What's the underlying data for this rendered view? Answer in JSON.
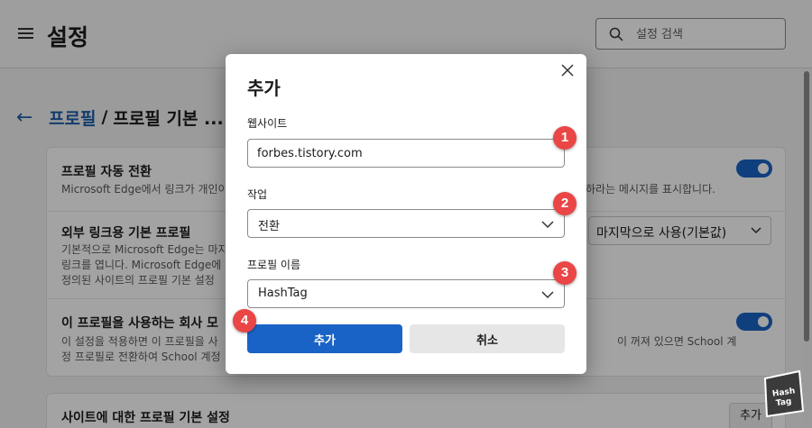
{
  "page": {
    "title": "설정",
    "search_placeholder": "설정 검색",
    "breadcrumb": {
      "link": "프로필",
      "separator": "/",
      "current": "프로필 기본 ..."
    }
  },
  "settings": {
    "auto_switch": {
      "title": "프로필 자동 전환",
      "desc_left": "Microsoft Edge에서 링크가 개인이",
      "desc_right": "하라는 메시지를 표시합니다.",
      "enabled": true
    },
    "external_link": {
      "title": "외부 링크용 기본 프로필",
      "desc_lines": [
        "기본적으로 Microsoft Edge는 마지",
        "링크를 엽니다. Microsoft Edge에",
        "정의된 사이트의 프로필 기본 설정"
      ],
      "dropdown_value": "마지막으로 사용(기본값)"
    },
    "work_profile": {
      "title": "이 프로필을 사용하는 회사 모",
      "desc_lines": [
        "이 설정을 적용하면 이 프로필을 사",
        "정 프로필로 전환하여 School 계정"
      ],
      "desc_right": "이 꺼져 있으면 School 계",
      "enabled": true
    },
    "site_defaults": {
      "title": "사이트에 대한 프로필 기본 설정",
      "add_label": "추가"
    }
  },
  "dialog": {
    "title": "추가",
    "website_label": "웹사이트",
    "website_value": "forbes.tistory.com",
    "action_label": "작업",
    "action_value": "전환",
    "profile_label": "프로필 이름",
    "profile_value": "HashTag",
    "add_button": "추가",
    "cancel_button": "취소"
  },
  "markers": [
    "1",
    "2",
    "3",
    "4"
  ],
  "watermark": {
    "line1": "Hash",
    "line2": "Tag"
  },
  "colors": {
    "accent": "#1a63c6",
    "marker": "#ea4646",
    "link": "#1f5faa"
  }
}
